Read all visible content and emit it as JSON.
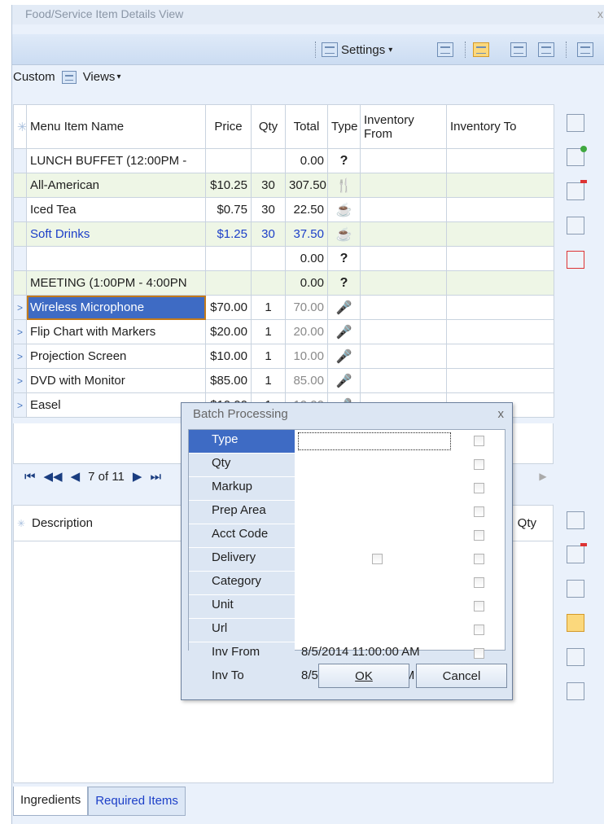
{
  "window": {
    "title": "Food/Service Item Details View",
    "close": "x"
  },
  "toolbar": {
    "settings_label": "Settings"
  },
  "view": {
    "custom_label": "Custom",
    "views_label": "Views"
  },
  "grid": {
    "columns": [
      "Menu Item Name",
      "Price",
      "Qty",
      "Total",
      "Type",
      "Inventory From",
      "Inventory To"
    ],
    "rows": [
      {
        "name": "LUNCH BUFFET (12:00PM -",
        "price": "",
        "qty": "",
        "total": "0.00",
        "type": "?"
      },
      {
        "name": "All-American",
        "price": "$10.25",
        "qty": "30",
        "total": "307.50",
        "type": "fork-knife"
      },
      {
        "name": "Iced Tea",
        "price": "$0.75",
        "qty": "30",
        "total": "22.50",
        "type": "cup"
      },
      {
        "name": "Soft Drinks",
        "price": "$1.25",
        "qty": "30",
        "total": "37.50",
        "type": "cup"
      },
      {
        "name": "",
        "price": "",
        "qty": "",
        "total": "0.00",
        "type": "?"
      },
      {
        "name": "MEETING (1:00PM - 4:00PN",
        "price": "",
        "qty": "",
        "total": "0.00",
        "type": "?"
      },
      {
        "name": "Wireless Microphone",
        "price": "$70.00",
        "qty": "1",
        "total": "70.00",
        "type": "mic"
      },
      {
        "name": "Flip Chart with Markers",
        "price": "$20.00",
        "qty": "1",
        "total": "20.00",
        "type": "mic"
      },
      {
        "name": "Projection Screen",
        "price": "$10.00",
        "qty": "1",
        "total": "10.00",
        "type": "mic"
      },
      {
        "name": "DVD with Monitor",
        "price": "$85.00",
        "qty": "1",
        "total": "85.00",
        "type": "mic"
      },
      {
        "name": "Easel",
        "price": "$10.00",
        "qty": "1",
        "total": "10.00",
        "type": "mic"
      }
    ],
    "glyphs": {
      "?": "?",
      "fork-knife": "🍴",
      "cup": "☕",
      "mic": "🎤"
    }
  },
  "pager": {
    "first": "⏮",
    "prev_page": "◀◀",
    "prev": "◀",
    "position": "7 of 11",
    "next": "▶",
    "last": "⏭"
  },
  "description_grid": {
    "col_description": "Description",
    "col_qty": "Qty"
  },
  "tabs": {
    "ingredients": "Ingredients",
    "required_items": "Required Items"
  },
  "batch_dialog": {
    "title": "Batch Processing",
    "close": "x",
    "fields": [
      {
        "label": "Type",
        "value": ""
      },
      {
        "label": "Qty",
        "value": ""
      },
      {
        "label": "Markup",
        "value": ""
      },
      {
        "label": "Prep Area",
        "value": ""
      },
      {
        "label": "Acct Code",
        "value": ""
      },
      {
        "label": "Delivery",
        "value": ""
      },
      {
        "label": "Category",
        "value": ""
      },
      {
        "label": "Unit",
        "value": ""
      },
      {
        "label": "Url",
        "value": ""
      },
      {
        "label": "Inv From",
        "value": "8/5/2014 11:00:00 AM"
      },
      {
        "label": "Inv To",
        "value": "8/5/2014 4:00:00 PM"
      }
    ],
    "ok_label": "OK",
    "cancel_label": "Cancel"
  }
}
